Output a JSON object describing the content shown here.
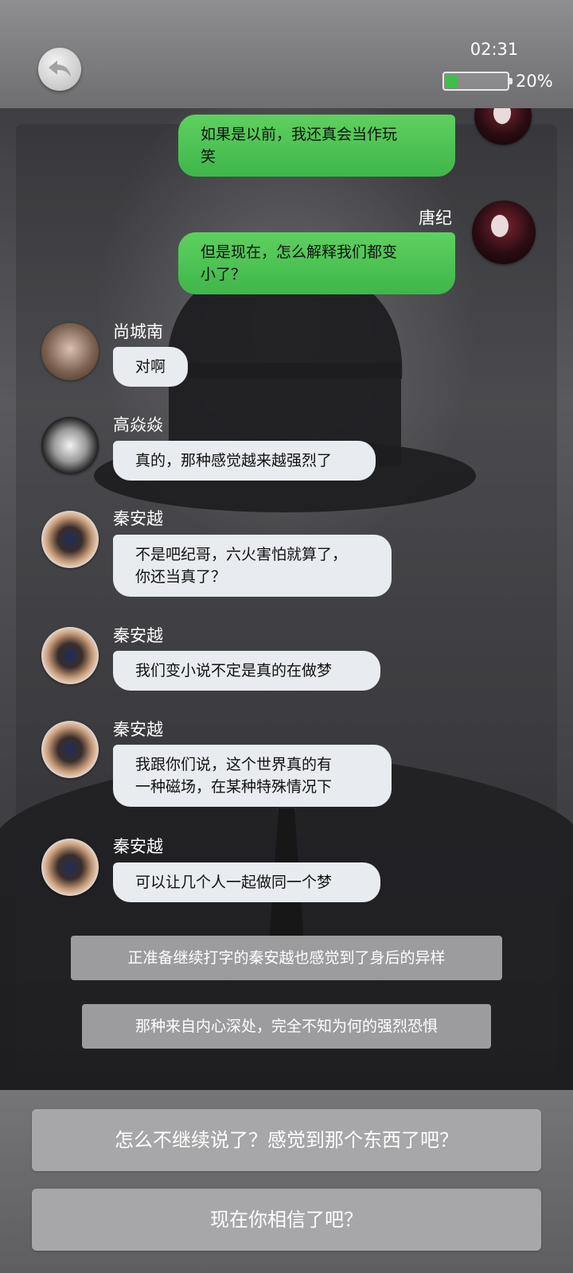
{
  "status": {
    "time": "02:31",
    "battery_label": "20%",
    "battery_level": 0.2
  },
  "chat": [
    {
      "speaker": "唐纪",
      "side": "out",
      "text": "如果是以前，我还真会当作玩\n笑"
    },
    {
      "speaker": "唐纪",
      "side": "out",
      "text": "但是现在，怎么解释我们都变\n小了？"
    },
    {
      "speaker": "尚城南",
      "side": "in",
      "text": "对啊"
    },
    {
      "speaker": "高焱焱",
      "side": "in",
      "text": "真的，那种感觉越来越强烈了"
    },
    {
      "speaker": "秦安越",
      "side": "in",
      "text": "不是吧纪哥，六火害怕就算了，\n你还当真了？"
    },
    {
      "speaker": "秦安越",
      "side": "in",
      "text": "我们变小说不定是真的在做梦"
    },
    {
      "speaker": "秦安越",
      "side": "in",
      "text": "我跟你们说，这个世界真的有\n一种磁场，在某种特殊情况下"
    },
    {
      "speaker": "秦安越",
      "side": "in",
      "text": "可以让几个人一起做同一个梦"
    }
  ],
  "narration": [
    "正准备继续打字的秦安越也感觉到了身后的异样",
    "那种来自内心深处，完全不知为何的强烈恐惧"
  ],
  "choices": [
    "怎么不继续说了？感觉到那个东西了吧？",
    "现在你相信了吧？"
  ],
  "icons": {
    "back": "back-arrow-icon"
  }
}
